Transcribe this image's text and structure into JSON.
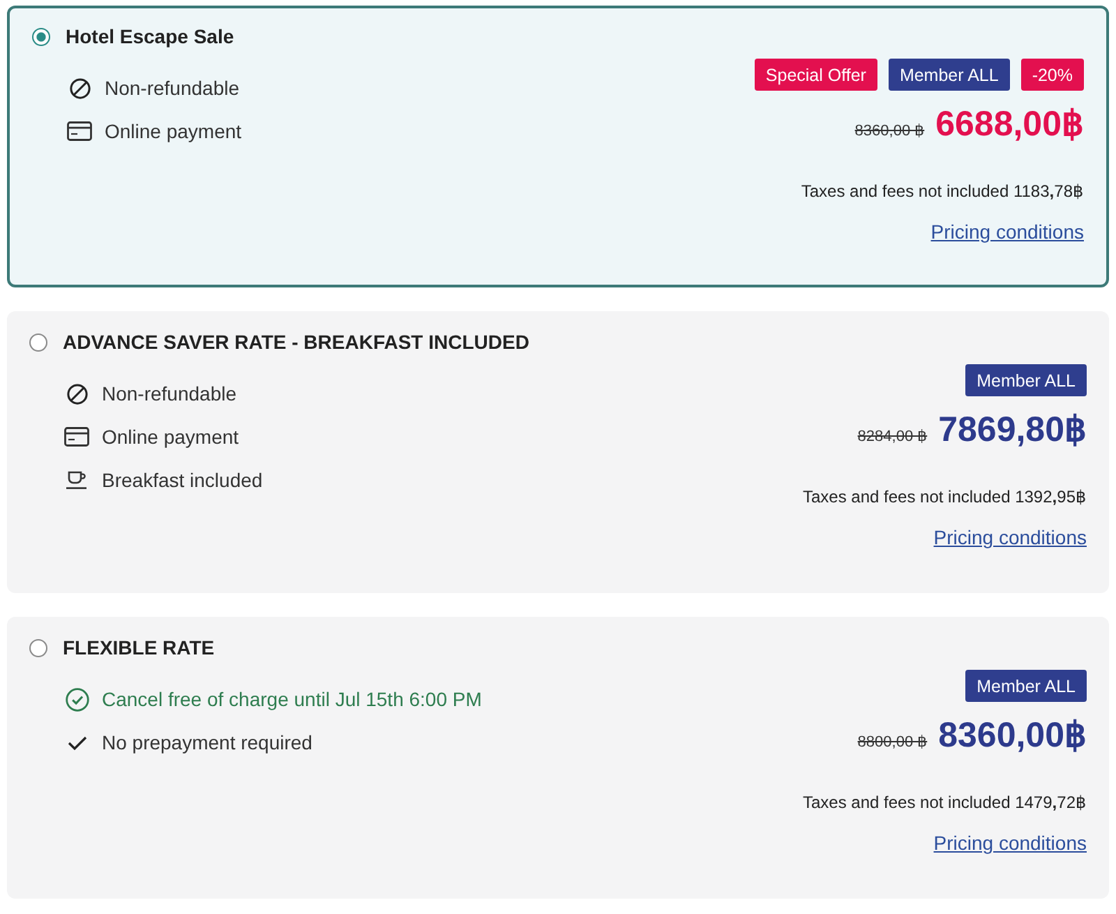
{
  "rates": [
    {
      "kind": "sale",
      "name": "Hotel Escape Sale",
      "selected": true,
      "features": [
        {
          "kind": "non-refundable",
          "text": "Non-refundable"
        },
        {
          "kind": "online-payment",
          "text": "Online payment"
        }
      ],
      "badges": [
        {
          "text": "Special Offer",
          "color": "#e3104f"
        },
        {
          "text": "Member ALL",
          "color": "#2f3e8e"
        },
        {
          "text": "-20%",
          "color": "#e3104f"
        }
      ],
      "original_price": "8360,00 ฿",
      "price": "6688,00฿",
      "taxes": "Taxes and fees not included 1183**,**78฿",
      "link": "Pricing conditions"
    },
    {
      "kind": "member",
      "name": "ADVANCE SAVER RATE - BREAKFAST INCLUDED",
      "selected": false,
      "features": [
        {
          "kind": "non-refundable",
          "text": "Non-refundable"
        },
        {
          "kind": "online-payment",
          "text": "Online payment"
        },
        {
          "kind": "breakfast",
          "text": "Breakfast included"
        }
      ],
      "badges": [
        {
          "text": "Member ALL",
          "color": "#2f3e8e"
        }
      ],
      "original_price": "8284,00 ฿",
      "price": "7869,80฿",
      "taxes": "Taxes and fees not included 1392**,**95฿",
      "link": "Pricing conditions"
    },
    {
      "kind": "member",
      "name": "FLEXIBLE RATE",
      "selected": false,
      "features": [
        {
          "kind": "free-cancellation",
          "text": "Cancel free of charge until Jul 15th 6:00 PM"
        },
        {
          "kind": "no-prepayment",
          "text": "No prepayment required"
        }
      ],
      "badges": [
        {
          "text": "Member ALL",
          "color": "#2f3e8e"
        }
      ],
      "original_price": "8800,00 ฿",
      "price": "8360,00฿",
      "taxes": "Taxes and fees not included 1479**,**72฿",
      "link": "Pricing conditions"
    }
  ]
}
